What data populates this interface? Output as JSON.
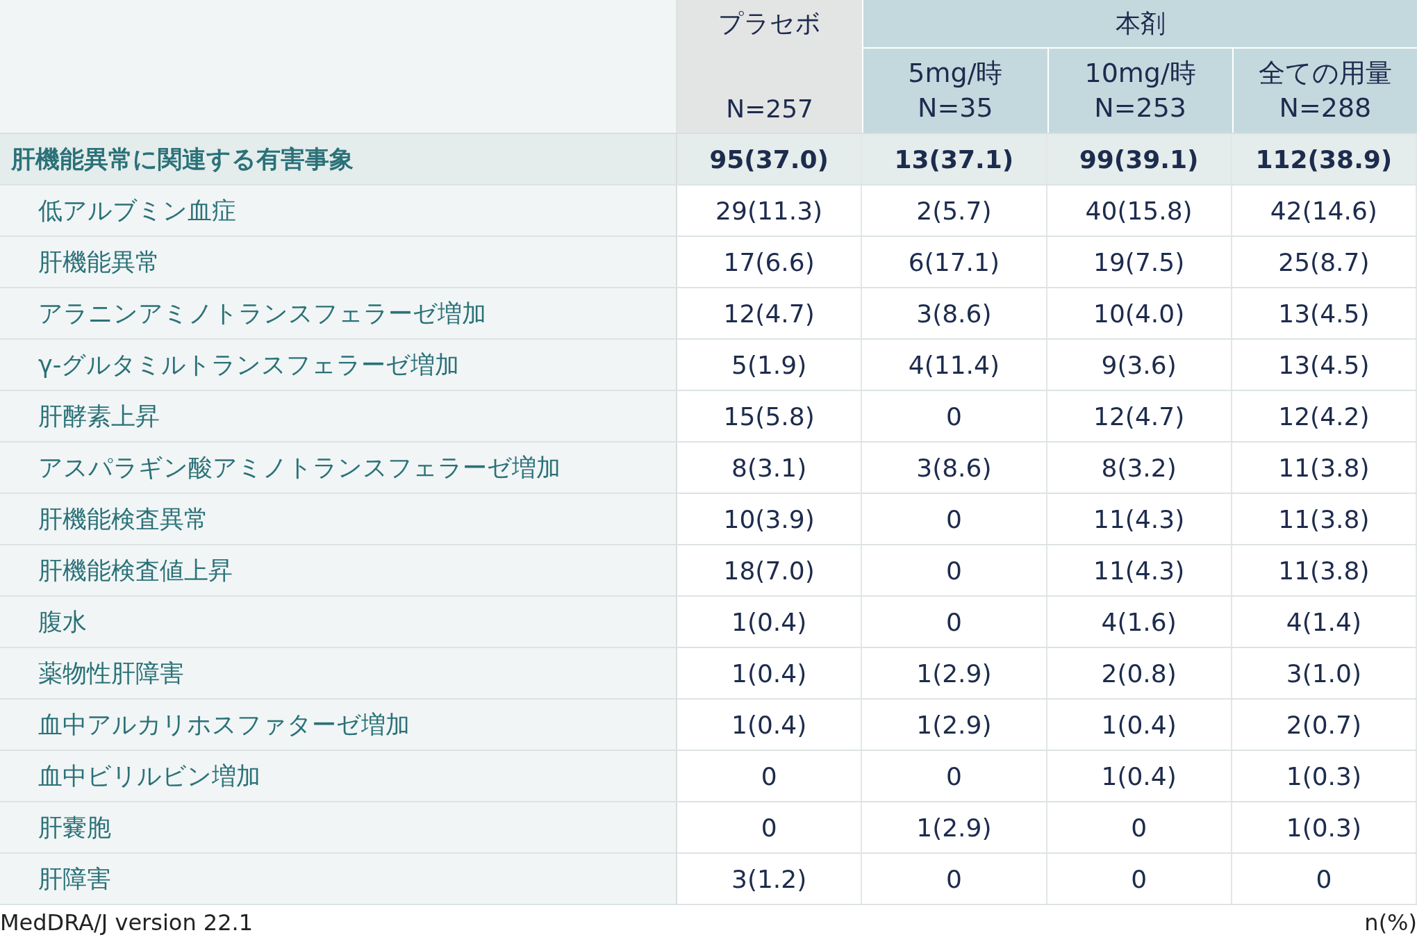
{
  "header": {
    "placebo": {
      "title": "プラセボ",
      "n": "N=257"
    },
    "drug": {
      "title": "本剤",
      "doses": [
        {
          "title": "5mg/時",
          "n": "N=35"
        },
        {
          "title": "10mg/時",
          "n": "N=253"
        },
        {
          "title": "全ての用量",
          "n": "N=288"
        }
      ]
    }
  },
  "rows": [
    {
      "kind": "category",
      "label": "肝機能異常に関連する有害事象",
      "values": [
        "95(37.0)",
        "13(37.1)",
        "99(39.1)",
        "112(38.9)"
      ]
    },
    {
      "kind": "item",
      "label": "低アルブミン血症",
      "values": [
        "29(11.3)",
        "2(5.7)",
        "40(15.8)",
        "42(14.6)"
      ]
    },
    {
      "kind": "item",
      "label": "肝機能異常",
      "values": [
        "17(6.6)",
        "6(17.1)",
        "19(7.5)",
        "25(8.7)"
      ]
    },
    {
      "kind": "item",
      "label": "アラニンアミノトランスフェラーゼ増加",
      "values": [
        "12(4.7)",
        "3(8.6)",
        "10(4.0)",
        "13(4.5)"
      ]
    },
    {
      "kind": "item",
      "label": "γ-グルタミルトランスフェラーゼ増加",
      "values": [
        "5(1.9)",
        "4(11.4)",
        "9(3.6)",
        "13(4.5)"
      ]
    },
    {
      "kind": "item",
      "label": "肝酵素上昇",
      "values": [
        "15(5.8)",
        "0",
        "12(4.7)",
        "12(4.2)"
      ]
    },
    {
      "kind": "item",
      "label": "アスパラギン酸アミノトランスフェラーゼ増加",
      "values": [
        "8(3.1)",
        "3(8.6)",
        "8(3.2)",
        "11(3.8)"
      ]
    },
    {
      "kind": "item",
      "label": "肝機能検査異常",
      "values": [
        "10(3.9)",
        "0",
        "11(4.3)",
        "11(3.8)"
      ]
    },
    {
      "kind": "item",
      "label": "肝機能検査値上昇",
      "values": [
        "18(7.0)",
        "0",
        "11(4.3)",
        "11(3.8)"
      ]
    },
    {
      "kind": "item",
      "label": "腹水",
      "values": [
        "1(0.4)",
        "0",
        "4(1.6)",
        "4(1.4)"
      ]
    },
    {
      "kind": "item",
      "label": "薬物性肝障害",
      "values": [
        "1(0.4)",
        "1(2.9)",
        "2(0.8)",
        "3(1.0)"
      ]
    },
    {
      "kind": "item",
      "label": "血中アルカリホスファターゼ増加",
      "values": [
        "1(0.4)",
        "1(2.9)",
        "1(0.4)",
        "2(0.7)"
      ]
    },
    {
      "kind": "item",
      "label": "血中ビリルビン増加",
      "values": [
        "0",
        "0",
        "1(0.4)",
        "1(0.3)"
      ]
    },
    {
      "kind": "item",
      "label": "肝嚢胞",
      "values": [
        "0",
        "1(2.9)",
        "0",
        "1(0.3)"
      ]
    },
    {
      "kind": "item",
      "label": "肝障害",
      "values": [
        "3(1.2)",
        "0",
        "0",
        "0"
      ]
    }
  ],
  "footer": {
    "note": "MedDRA/J version 22.1",
    "unit": "n(%)"
  }
}
